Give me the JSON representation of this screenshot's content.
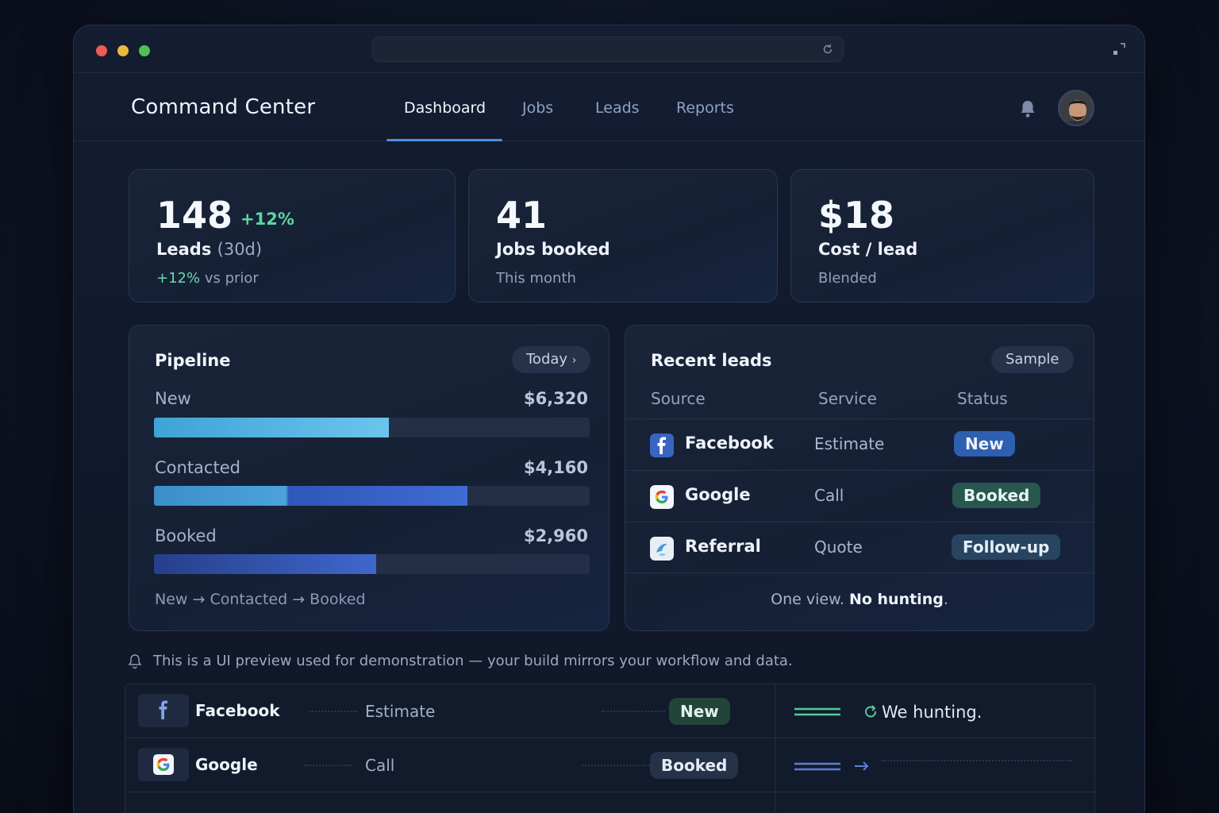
{
  "app": {
    "title": "Command Center",
    "nav": [
      {
        "label": "Dashboard",
        "active": true
      },
      {
        "label": "Jobs"
      },
      {
        "label": "Leads"
      },
      {
        "label": "Reports"
      }
    ]
  },
  "stats": [
    {
      "value": "148",
      "delta": "+12%",
      "label": "Leads",
      "label_suffix": "(30d)",
      "sub_highlight": "+12%",
      "sub": "vs prior"
    },
    {
      "value": "41",
      "label": "Jobs booked",
      "sub": "This month"
    },
    {
      "value": "$18",
      "label": "Cost / lead",
      "sub": "Blended"
    }
  ],
  "pipeline": {
    "title": "Pipeline",
    "range_label": "Today",
    "stages": [
      {
        "label": "New",
        "value": "$6,320",
        "fraction": 0.54
      },
      {
        "label": "Contacted",
        "value": "$4,160",
        "fraction": 0.72
      },
      {
        "label": "Booked",
        "value": "$2,960",
        "fraction": 0.51
      }
    ],
    "flow": [
      "New",
      "Contacted",
      "Booked"
    ],
    "flow_arrow": "→"
  },
  "recent_leads": {
    "title": "Recent leads",
    "badge": "Sample",
    "columns": [
      "Source",
      "Service",
      "Status"
    ],
    "rows": [
      {
        "source": "Facebook",
        "service": "Estimate",
        "status": "New",
        "status_kind": "new",
        "icon": "facebook-icon"
      },
      {
        "source": "Google",
        "service": "Call",
        "status": "Booked",
        "status_kind": "booked",
        "icon": "google-icon"
      },
      {
        "source": "Referral",
        "service": "Quote",
        "status": "Follow-up",
        "status_kind": "follow",
        "icon": "referral-icon"
      }
    ],
    "tagline_prefix": "One view.",
    "tagline_bold": "No hunting",
    "tagline_suffix": "."
  },
  "notice": {
    "text": "This is a UI preview used for demonstration — your build mirrors your workflow and data.",
    "icon": "bell-outline-icon"
  },
  "bottom_table": {
    "rows": [
      {
        "source": "Facebook",
        "service": "Estimate",
        "status": "New",
        "icon": "facebook-icon"
      },
      {
        "source": "Google",
        "service": "Call",
        "status": "Booked",
        "icon": "google-icon"
      }
    ],
    "side_text": "We hunting."
  },
  "colors": {
    "accent": "#4d8fe0",
    "positive": "#5cd6a0",
    "bar_new": "#5bb8e6",
    "bar_contacted": "#3f6fd0",
    "bar_booked": "#2e4fa8"
  }
}
